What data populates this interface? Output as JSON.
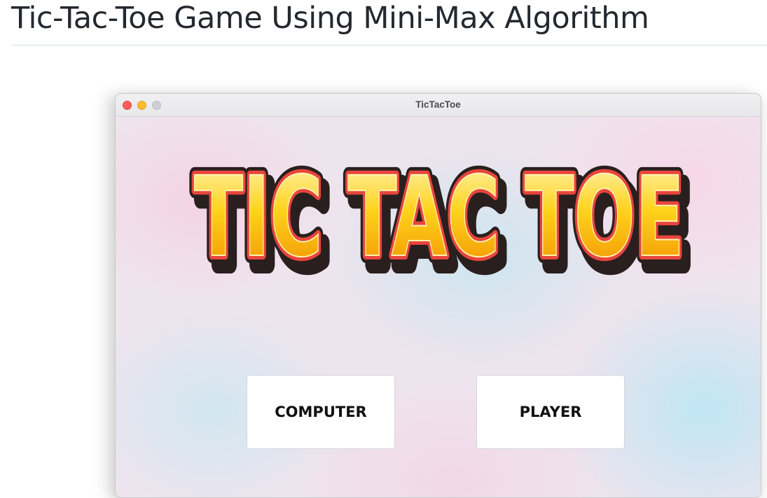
{
  "page": {
    "title": "Tic-Tac-Toe Game Using Mini-Max Algorithm"
  },
  "window": {
    "title": "TicTacToe",
    "traffic_lights": {
      "close_color": "#ff5f57",
      "minimize_color": "#febc2e",
      "zoom_color": "#d0d0d3"
    }
  },
  "logo": {
    "text": "TIC TAC TOE",
    "colors": {
      "fill_top": "#fff7c2",
      "fill_mid": "#ffd21a",
      "fill_bottom": "#f08a00",
      "outline": "#e8453c",
      "shadow": "#2a1f1f"
    }
  },
  "menu": {
    "computer_label": "COMPUTER",
    "player_label": "PLAYER"
  }
}
